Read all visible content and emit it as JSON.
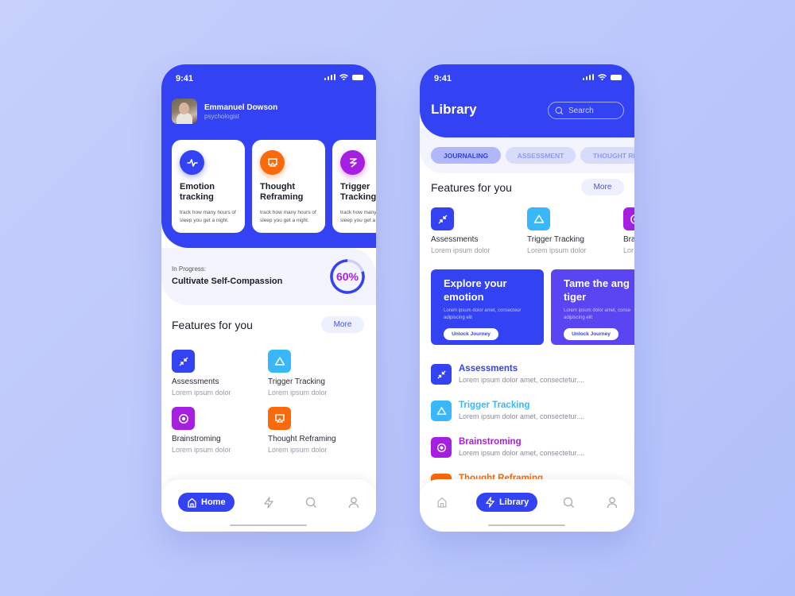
{
  "status_bar": {
    "time": "9:41"
  },
  "colors": {
    "primary": "#3343f3",
    "orange": "#fa6a0a",
    "purple": "#a41fe0",
    "cyan": "#38b8fb",
    "progress_text": "#a41fe0"
  },
  "home_screen": {
    "profile": {
      "name": "Emmanuel Dowson",
      "role": "psychologist"
    },
    "feature_cards": [
      {
        "title": "Emotion tracking",
        "description": "track how many hours of sleep you get a night.",
        "icon": "pulse-icon",
        "color": "#3343f3"
      },
      {
        "title": "Thought Reframing",
        "description": "track how many hours of sleep you get a night.",
        "icon": "screen-icon",
        "color": "#fa6a0a"
      },
      {
        "title": "Trigger Tracking",
        "description": "track how many hours of sleep you get a night.",
        "icon": "zigzag-icon",
        "color": "#a41fe0"
      }
    ],
    "progress": {
      "label": "In Progress:",
      "title": "Cultivate Self-Compassion",
      "percent": 60,
      "percent_label": "60%"
    },
    "features": {
      "heading": "Features for you",
      "more_label": "More",
      "items": [
        {
          "title": "Assessments",
          "subtitle": "Lorem ipsum dolor",
          "icon": "compress-arrows-icon",
          "color": "#3343f3"
        },
        {
          "title": "Trigger Tracking",
          "subtitle": "Lorem ipsum dolor",
          "icon": "triangle-icon",
          "color": "#38b8fb"
        },
        {
          "title": "Brainstroming",
          "subtitle": "Lorem ipsum dolor",
          "icon": "target-icon",
          "color": "#a41fe0"
        },
        {
          "title": "Thought Reframing",
          "subtitle": "Lorem ipsum dolor",
          "icon": "screen-icon",
          "color": "#fa6a0a"
        }
      ]
    },
    "nav": {
      "active_label": "Home"
    }
  },
  "library_screen": {
    "title": "Library",
    "search_placeholder": "Search",
    "chips": [
      {
        "label": "JOURNALING",
        "active": true
      },
      {
        "label": "ASSESSMENT",
        "active": false
      },
      {
        "label": "THOUGHT RE",
        "active": false
      }
    ],
    "features": {
      "heading": "Features for you",
      "more_label": "More",
      "items": [
        {
          "title": "Assessments",
          "subtitle": "Lorem ipsum dolor"
        },
        {
          "title": "Trigger Tracking",
          "subtitle": "Lorem ipsum dolor"
        },
        {
          "title": "Bra",
          "subtitle": "Lor"
        }
      ]
    },
    "journeys": [
      {
        "title": "Explore your emotion",
        "description": "Lorem ipsum dolor amet, consecteur adipiscing elit",
        "button": "Unlock Journey",
        "color": "#3343f3"
      },
      {
        "title": "Tame the ang tiger",
        "description": "Lorem ipsum dolor amet, conse adipiscing elit",
        "button": "Unlock Journey",
        "color": "#5b45f2"
      }
    ],
    "list": [
      {
        "title": "Assessments",
        "subtitle": "Lorem ipsum dolor  amet, consectetur....",
        "color": "#3343f3"
      },
      {
        "title": "Trigger Tracking",
        "subtitle": "Lorem ipsum dolor  amet, consectetur....",
        "color": "#38b8fb"
      },
      {
        "title": "Brainstroming",
        "subtitle": "Lorem ipsum dolor  amet, consectetur....",
        "color": "#a41fe0"
      },
      {
        "title": "Thought Reframing",
        "subtitle": "",
        "color": "#fa6a0a"
      }
    ],
    "nav": {
      "active_label": "Library"
    }
  }
}
